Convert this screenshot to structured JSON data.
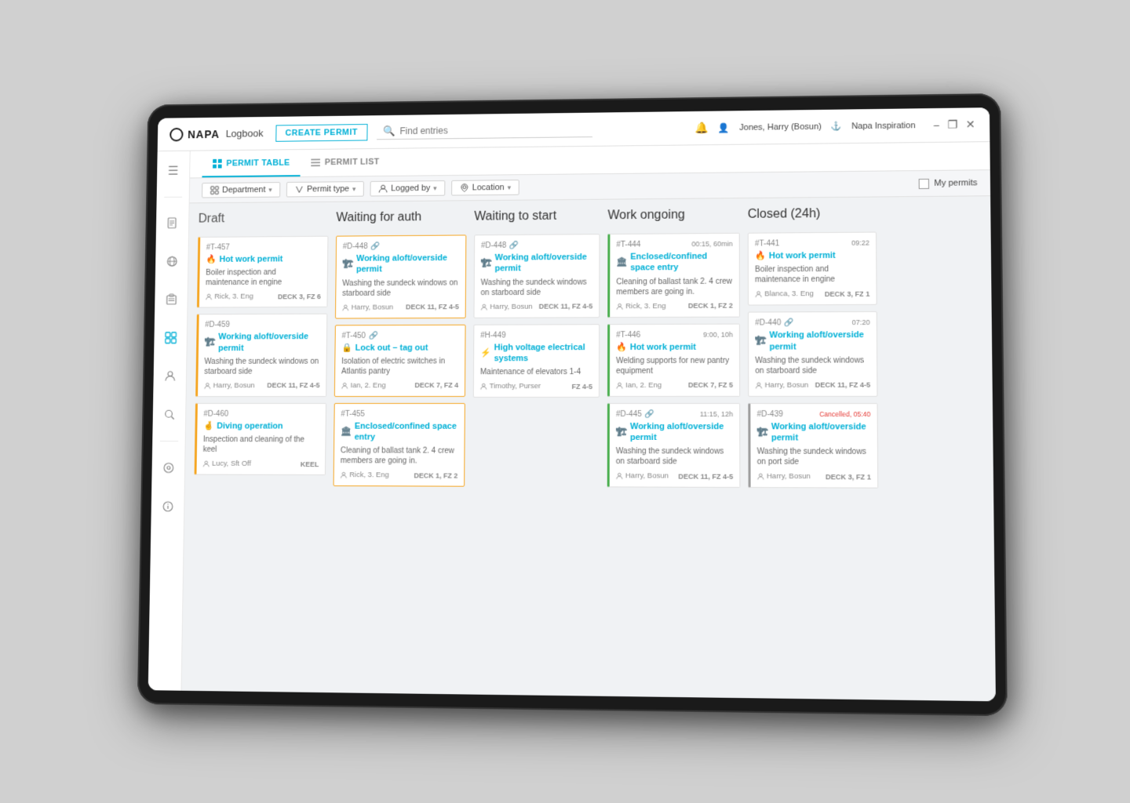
{
  "app": {
    "logo": "NAPA",
    "logo_sub": "Logbook",
    "create_permit_label": "CREATE PERMIT",
    "search_placeholder": "Find entries"
  },
  "top_bar_right": {
    "bell_label": "🔔",
    "user_label": "Jones, Harry (Bosun)",
    "ship_label": "Napa Inspiration"
  },
  "nav_tabs": [
    {
      "id": "permit-table",
      "label": "PERMIT TABLE",
      "active": true
    },
    {
      "id": "permit-list",
      "label": "PERMIT LIST",
      "active": false
    }
  ],
  "filters": {
    "department_label": "Department",
    "permit_type_label": "Permit type",
    "logged_by_label": "Logged by",
    "location_label": "Location",
    "my_permits_label": "My permits"
  },
  "columns": [
    {
      "id": "draft",
      "title": "Draft",
      "cards": [
        {
          "id": "#T-457",
          "has_link": false,
          "title": "Hot work permit",
          "title_icon": "🔥",
          "desc": "Boiler inspection and maintenance in engine",
          "user": "Rick, 3. Eng",
          "location": "DECK 3, FZ 6",
          "time": null,
          "border": "orange-left"
        },
        {
          "id": "#D-459",
          "has_link": false,
          "title": "Working aloft/overside permit",
          "title_icon": "🏗",
          "desc": "Washing the sundeck windows on starboard side",
          "user": "Harry, Bosun",
          "location": "DECK 11, FZ 4-5",
          "time": null,
          "border": "orange-left"
        },
        {
          "id": "#D-460",
          "has_link": false,
          "title": "Diving operation",
          "title_icon": "🤿",
          "desc": "Inspection and cleaning of the keel",
          "user": "Lucy, Sft Off",
          "location": "KEEL",
          "time": null,
          "border": "orange-left"
        }
      ]
    },
    {
      "id": "waiting-auth",
      "title": "Waiting for auth",
      "cards": [
        {
          "id": "#D-448",
          "has_link": true,
          "title": "Working aloft/overside permit",
          "title_icon": "🏗",
          "desc": "Washing the sundeck windows on starboard side",
          "user": "Harry, Bosun",
          "location": "DECK 11, FZ 4-5",
          "time": null,
          "border": "orange-border"
        },
        {
          "id": "#T-450",
          "has_link": true,
          "title": "Lock out – tag out",
          "title_icon": "🔒",
          "desc": "Isolation of electric switches in Atlantis pantry",
          "user": "Ian, 2. Eng",
          "location": "DECK 7, FZ 4",
          "time": null,
          "border": "orange-border"
        },
        {
          "id": "#T-455",
          "has_link": false,
          "title": "Enclosed/confined space entry",
          "title_icon": "🏢",
          "desc": "Cleaning of ballast tank 2. 4 crew members are going in.",
          "user": "Rick, 3. Eng",
          "location": "DECK 1, FZ 2",
          "time": null,
          "border": "orange-border"
        }
      ]
    },
    {
      "id": "waiting-start",
      "title": "Waiting to start",
      "cards": [
        {
          "id": "#D-448",
          "has_link": true,
          "title": "Working aloft/overside permit",
          "title_icon": "🏗",
          "desc": "Washing the sundeck windows on starboard side",
          "user": "Harry, Bosun",
          "location": "DECK 11, FZ 4-5",
          "time": null,
          "border": "none"
        },
        {
          "id": "#H-449",
          "has_link": false,
          "title": "High voltage electrical systems",
          "title_icon": "⚡",
          "desc": "Maintenance of elevators 1-4",
          "user": "Timothy, Purser",
          "location": "FZ 4-5",
          "time": null,
          "border": "none"
        }
      ]
    },
    {
      "id": "work-ongoing",
      "title": "Work ongoing",
      "cards": [
        {
          "id": "#T-444",
          "has_link": false,
          "title": "Enclosed/confined space entry",
          "title_icon": "🏢",
          "desc": "Cleaning of ballast tank 2. 4 crew members are going in.",
          "user": "Rick, 3. Eng",
          "location": "DECK 1, FZ 2",
          "time": "00:15, 60min",
          "border": "green-left"
        },
        {
          "id": "#T-446",
          "has_link": false,
          "title": "Hot work permit",
          "title_icon": "🔥",
          "desc": "Welding supports for new pantry equipment",
          "user": "Ian, 2. Eng",
          "location": "DECK 7, FZ 5",
          "time": "9:00, 10h",
          "border": "green-left"
        },
        {
          "id": "#D-445",
          "has_link": true,
          "title": "Working aloft/overside permit",
          "title_icon": "🏗",
          "desc": "Washing the sundeck windows on starboard side",
          "user": "Harry, Bosun",
          "location": "DECK 11, FZ 4-5",
          "time": "11:15, 12h",
          "border": "green-left"
        }
      ]
    },
    {
      "id": "closed",
      "title": "Closed (24h)",
      "cards": [
        {
          "id": "#T-441",
          "has_link": false,
          "title": "Hot work permit",
          "title_icon": "🔥",
          "desc": "Boiler inspection and maintenance in engine",
          "user": "Blanca, 3. Eng",
          "location": "DECK 3, FZ 1",
          "time": "09:22",
          "border": "none"
        },
        {
          "id": "#D-440",
          "has_link": true,
          "title": "Working aloft/overside permit",
          "title_icon": "🏗",
          "desc": "Washing the sundeck windows on starboard side",
          "user": "Harry, Bosun",
          "location": "DECK 11, FZ 4-5",
          "time": "07:20",
          "border": "none"
        },
        {
          "id": "#D-439",
          "has_link": false,
          "title": "Working aloft/overside permit",
          "title_icon": "🏗",
          "desc": "Washing the sundeck windows on port side",
          "user": "Harry, Bosun",
          "location": "DECK 3, FZ 1",
          "time": "Cancelled, 05:40",
          "border": "none",
          "cancelled": true
        }
      ]
    }
  ],
  "sidebar_icons": [
    {
      "id": "menu",
      "icon": "☰",
      "active": false
    },
    {
      "id": "doc",
      "icon": "📄",
      "active": false
    },
    {
      "id": "globe",
      "icon": "🌐",
      "active": false
    },
    {
      "id": "clipboard",
      "icon": "📋",
      "active": false
    },
    {
      "id": "grid",
      "icon": "⊞",
      "active": true
    },
    {
      "id": "user",
      "icon": "👤",
      "active": false
    },
    {
      "id": "search",
      "icon": "🔍",
      "active": false
    },
    {
      "id": "tools",
      "icon": "⚙",
      "active": false
    },
    {
      "id": "settings",
      "icon": "⚙",
      "active": false
    },
    {
      "id": "info",
      "icon": "ℹ",
      "active": false
    }
  ]
}
